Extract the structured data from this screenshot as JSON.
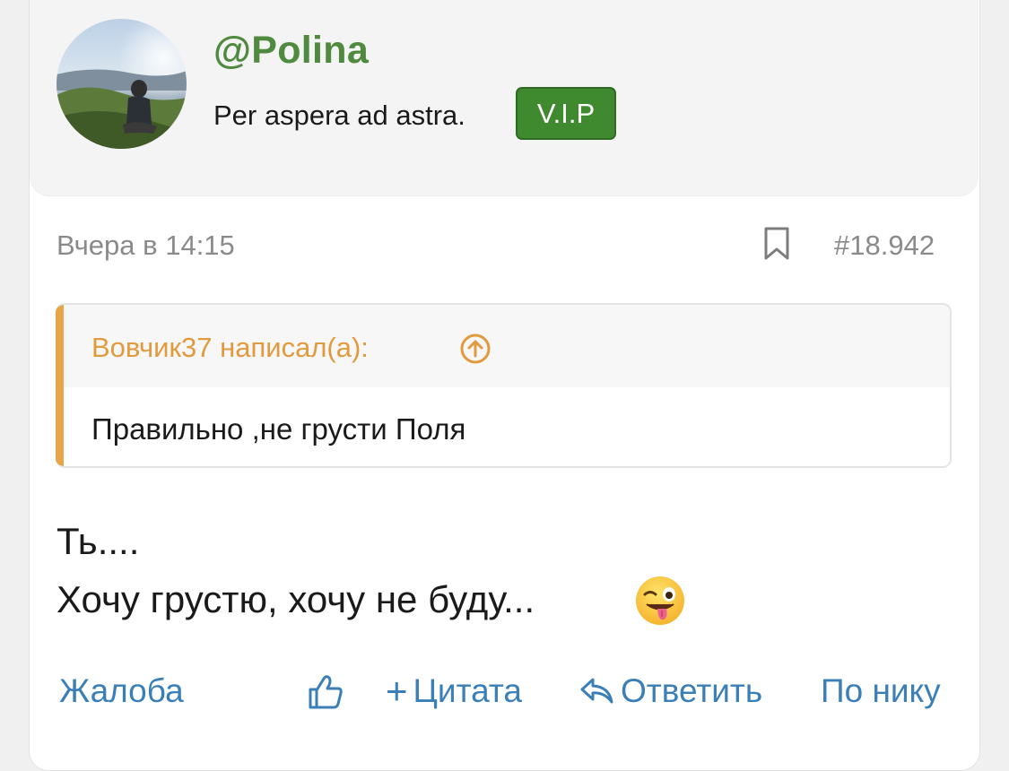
{
  "author": {
    "username": "@Polina",
    "title": "Per aspera ad astra.",
    "badge": "V.I.P"
  },
  "post_meta": {
    "timestamp": "Вчера в 14:15",
    "post_number": "#18.942"
  },
  "quote": {
    "author": "Вовчик37 написал(а):",
    "text": "Правильно ,не грусти Поля"
  },
  "message": {
    "line1": "Ть....",
    "line2": "Хочу грустю, хочу не буду...",
    "emoji": "winking-face-with-tongue"
  },
  "actions": {
    "report": "Жалоба",
    "quote": "Цитата",
    "reply": "Ответить",
    "by_nick": "По нику"
  },
  "colors": {
    "username": "#4f8a3f",
    "badge_bg": "#3f8a2e",
    "quote_accent": "#e7a547",
    "link": "#3a7fb8",
    "meta": "#8a8a8a"
  }
}
